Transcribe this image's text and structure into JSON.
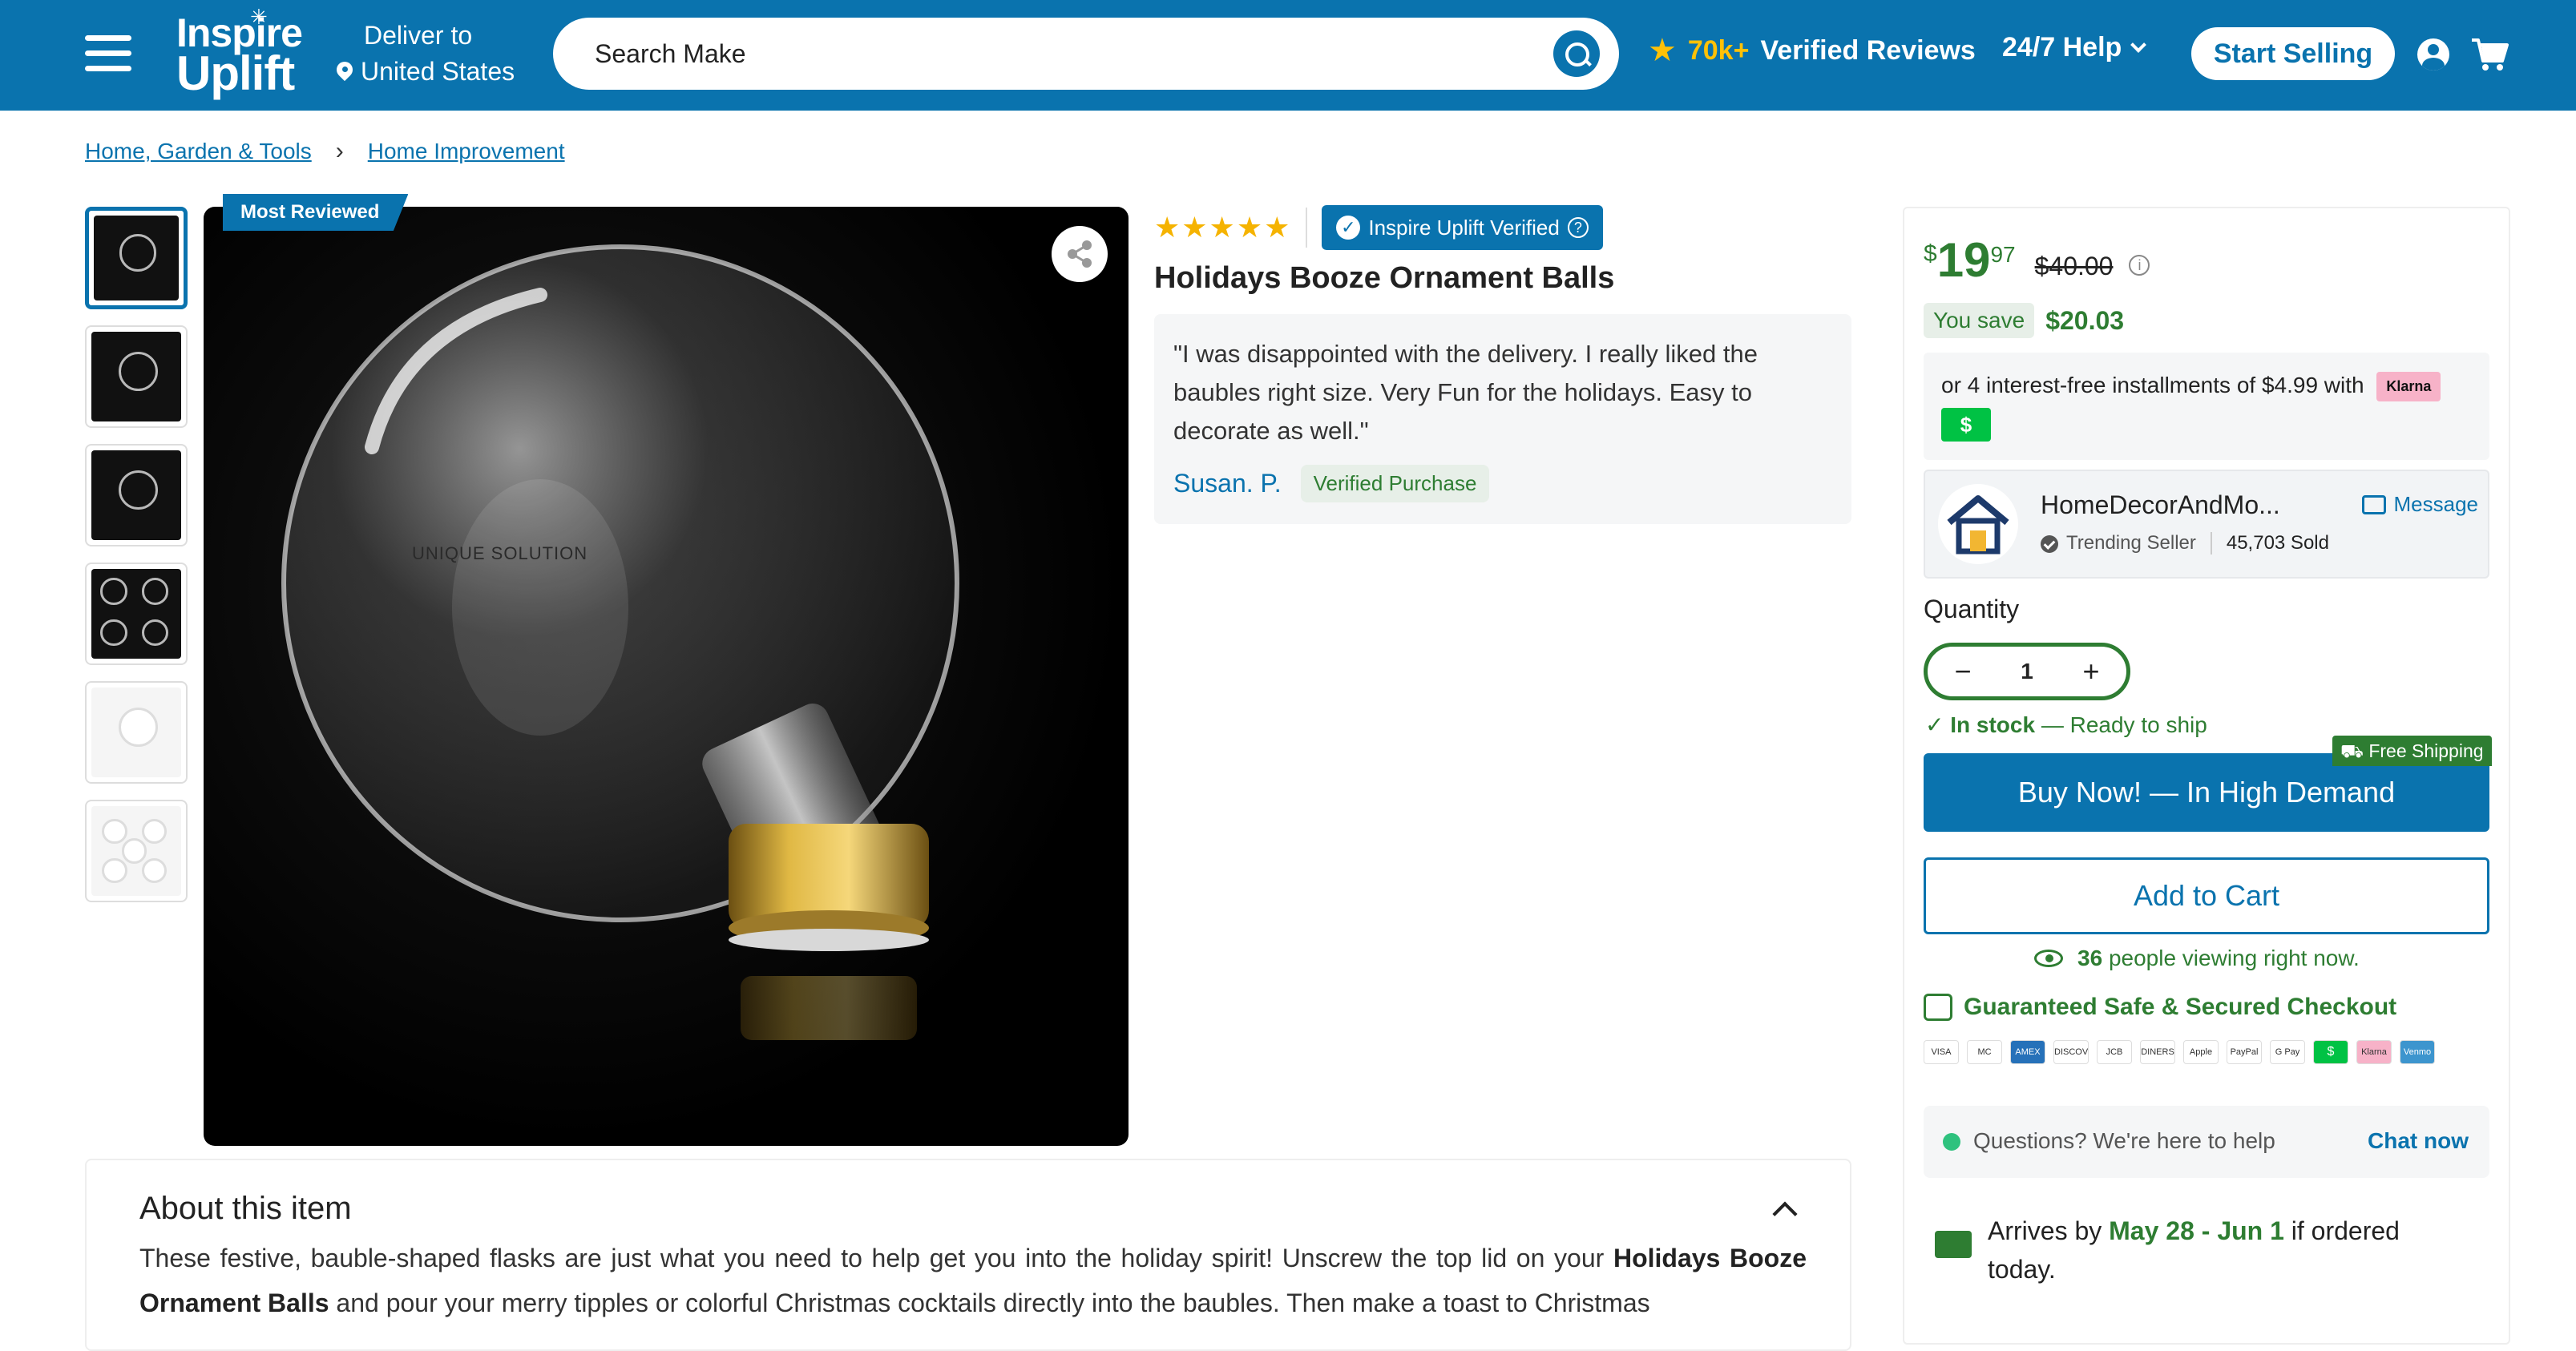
{
  "header": {
    "logo_line1": "Inspire",
    "logo_line2": "Uplift",
    "deliver_label": "Deliver to",
    "deliver_location": "United States",
    "search_placeholder": "Search Make",
    "reviews_count": "70k+",
    "reviews_label": "Verified Reviews",
    "help_label": "24/7 Help",
    "start_selling": "Start Selling",
    "brand_color": "#0a73ae"
  },
  "breadcrumb": {
    "items": [
      "Home, Garden & Tools",
      "Home Improvement"
    ],
    "separator": "›"
  },
  "gallery": {
    "badge": "Most Reviewed",
    "thumbnail_count": 6,
    "watermark": "UNIQUE SOLUTION"
  },
  "product": {
    "rating_stars": "★★★★★",
    "verified_badge": "Inspire Uplift Verified",
    "title": "Holidays Booze Ornament Balls",
    "review_quote": "\"I was disappointed with the delivery. I really liked the baubles right size. Very Fun for the holidays. Easy to decorate as well.\"",
    "review_author": "Susan. P.",
    "review_verified": "Verified Purchase"
  },
  "purchase": {
    "currency": "$",
    "price_whole": "19",
    "price_cents": "97",
    "price_old": "$40.00",
    "save_label": "You save",
    "save_amount": "$20.03",
    "installment_text": "or 4 interest-free installments of $4.99 with",
    "klarna": "Klarna",
    "cashapp": "$",
    "seller_name": "HomeDecorAndMo...",
    "seller_message": "Message",
    "seller_status": "Trending Seller",
    "seller_sold": "45,703 Sold",
    "quantity_label": "Quantity",
    "quantity_minus": "−",
    "quantity_value": "1",
    "quantity_plus": "+",
    "stock_status": "In stock",
    "stock_detail": "— Ready to ship",
    "free_shipping": "Free Shipping",
    "buy_now": "Buy Now! — In High Demand",
    "add_to_cart": "Add to Cart",
    "viewing_count": "36",
    "viewing_text": "people viewing right now.",
    "safe_checkout": "Guaranteed Safe & Secured Checkout",
    "payment_methods": [
      "VISA",
      "MC",
      "AMEX",
      "DISCOVER",
      "JCB",
      "DINERS",
      "Apple Pay",
      "PayPal",
      "G Pay",
      "$",
      "Klarna",
      "Venmo"
    ],
    "questions_text": "Questions? We're here to help",
    "chat_now": "Chat now",
    "arrives_prefix": "Arrives by",
    "arrives_dates": "May 28 - Jun 1",
    "arrives_suffix": "if ordered today."
  },
  "about": {
    "heading": "About this item",
    "text_1": "These festive, bauble-shaped flasks are just what you need to help get you into the holiday spirit! Unscrew the top lid on your ",
    "text_bold": "Holidays Booze Ornament Balls",
    "text_2": " and pour your merry tipples or colorful Christmas cocktails directly into the baubles. Then make a toast to Christmas"
  }
}
